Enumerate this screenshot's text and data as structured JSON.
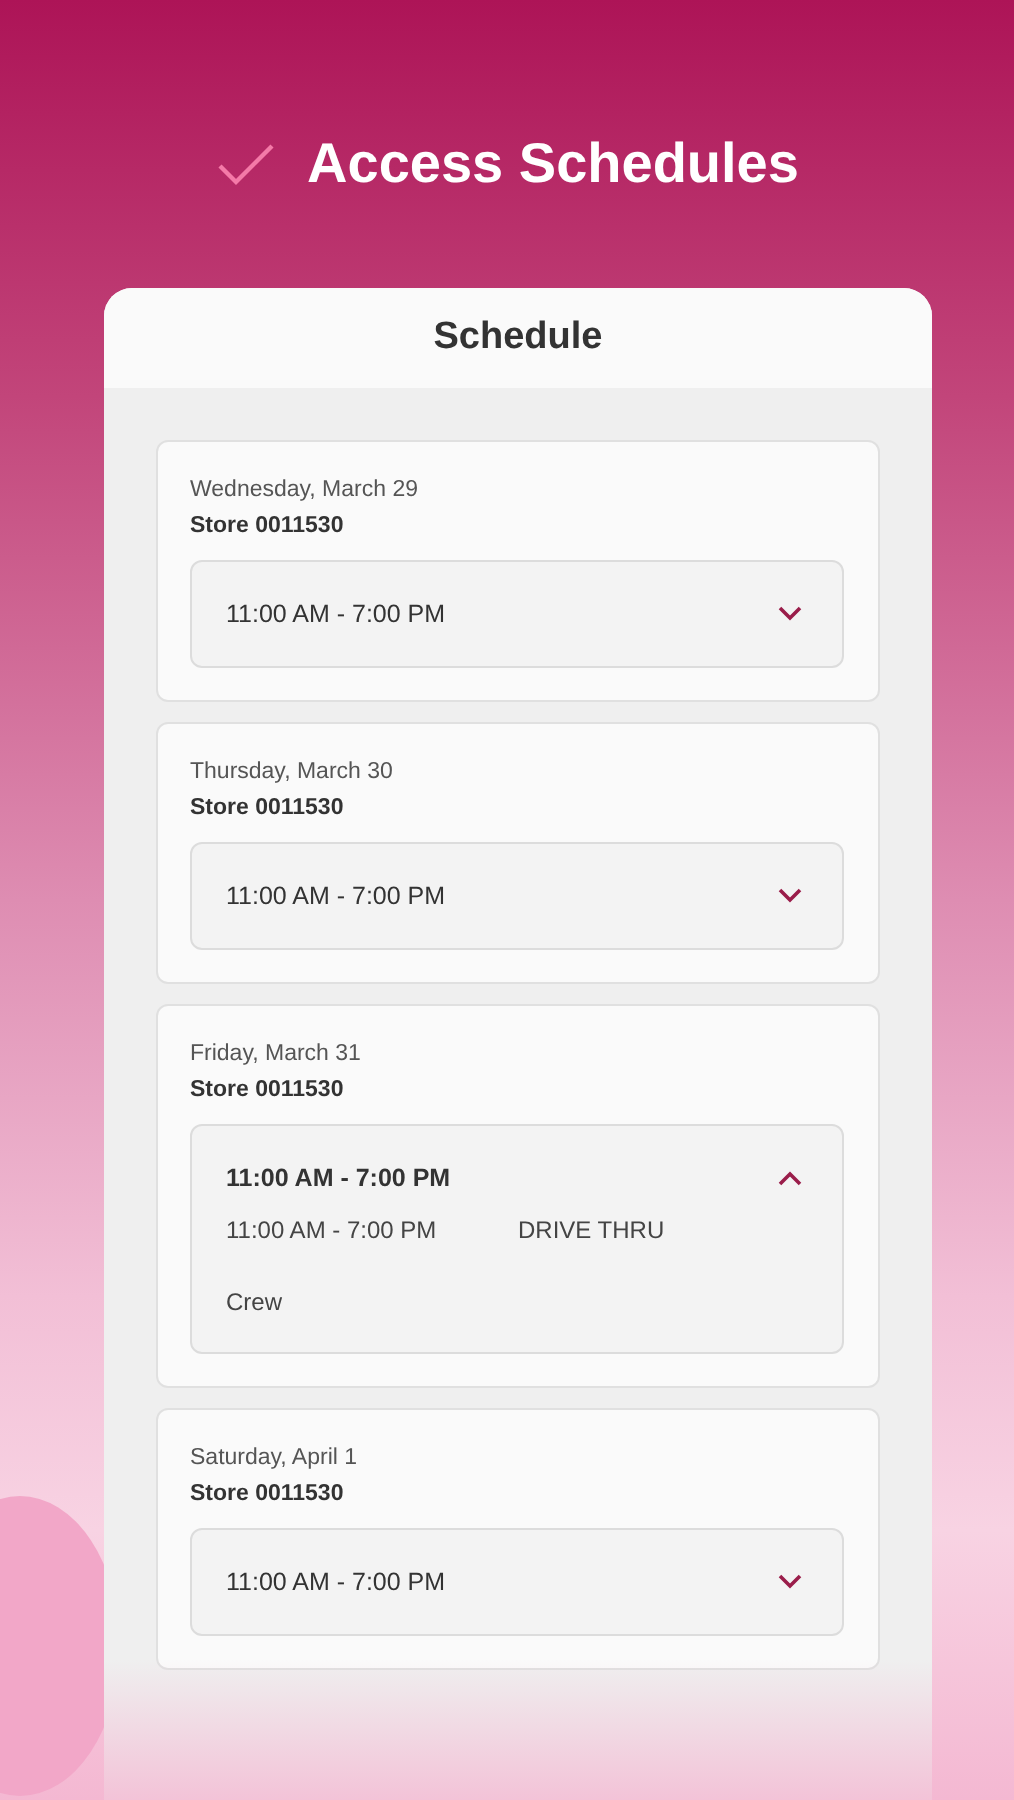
{
  "headline": "Access Schedules",
  "screen": {
    "title": "Schedule"
  },
  "days": [
    {
      "date": "Wednesday, March 29",
      "store": "Store 0011530",
      "shift": "11:00 AM - 7:00 PM",
      "expanded": false
    },
    {
      "date": "Thursday, March 30",
      "store": "Store 0011530",
      "shift": "11:00 AM - 7:00 PM",
      "expanded": false
    },
    {
      "date": "Friday, March 31",
      "store": "Store 0011530",
      "shift": "11:00 AM - 7:00 PM",
      "expanded": true,
      "details": {
        "time": "11:00 AM - 7:00 PM",
        "station": "DRIVE THRU",
        "role": "Crew"
      }
    },
    {
      "date": "Saturday, April 1",
      "store": "Store 0011530",
      "shift": "11:00 AM - 7:00 PM",
      "expanded": false
    }
  ]
}
